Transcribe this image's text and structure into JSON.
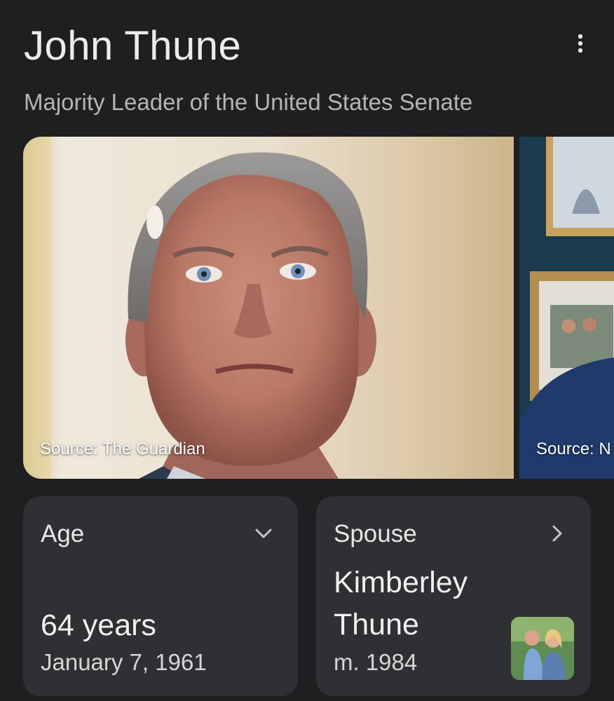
{
  "header": {
    "title": "John Thune",
    "subtitle": "Majority Leader of the United States Senate",
    "more_icon": "more-vert-icon"
  },
  "images": [
    {
      "source": "Source: The Guardian"
    },
    {
      "source": "Source: N"
    }
  ],
  "cards": {
    "age": {
      "label": "Age",
      "value": "64 years",
      "detail": "January 7, 1961",
      "icon": "chevron-down-icon"
    },
    "spouse": {
      "label": "Spouse",
      "value_line1": "Kimberley",
      "value_line2": "Thune",
      "detail": "m. 1984",
      "icon": "chevron-right-icon"
    }
  },
  "colors": {
    "background": "#1f1f21",
    "card": "#2f3034",
    "subtitle": "#b4b5b9"
  }
}
